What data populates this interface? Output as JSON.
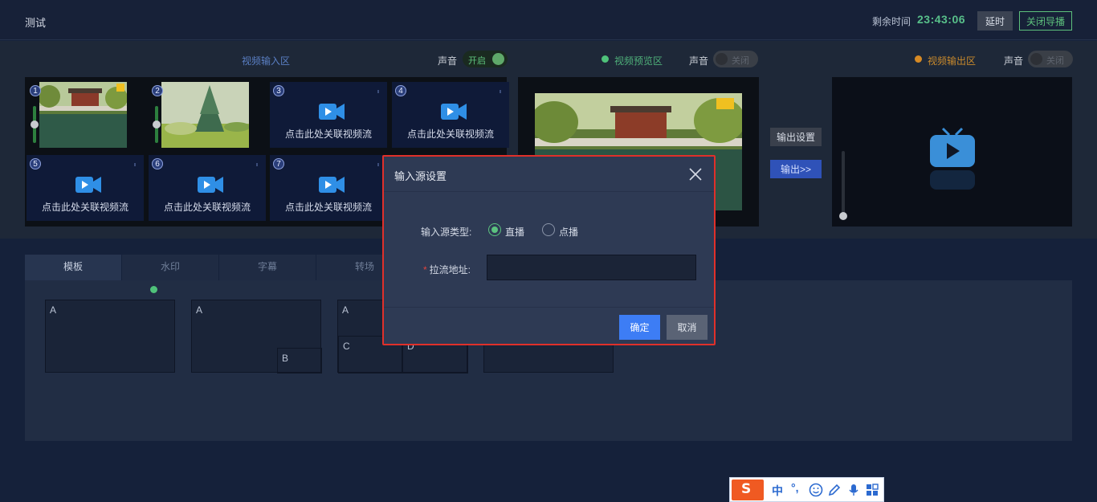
{
  "header": {
    "title": "测试",
    "remain_label": "剩余时间",
    "remain_time": "23:43:06",
    "delay_label": "延时",
    "close_live_label": "关闭导播"
  },
  "input_area": {
    "label": "视频输入区",
    "sound_label": "声音",
    "sound_toggle": "开启",
    "cells": [
      {
        "num": "1",
        "text": ""
      },
      {
        "num": "2",
        "text": ""
      },
      {
        "num": "3",
        "text": "点击此处关联视频流"
      },
      {
        "num": "4",
        "text": "点击此处关联视频流"
      },
      {
        "num": "5",
        "text": "点击此处关联视频流"
      },
      {
        "num": "6",
        "text": "点击此处关联视频流"
      },
      {
        "num": "7",
        "text": "点击此处关联视频流"
      }
    ]
  },
  "preview_area": {
    "label": "视频预览区",
    "sound_label": "声音",
    "sound_toggle": "关闭",
    "output_settings_label": "输出设置",
    "output_label": "输出>>"
  },
  "output_area": {
    "label": "视频输出区",
    "sound_label": "声音",
    "sound_toggle": "关闭"
  },
  "tabs": [
    {
      "label": "模板",
      "active": true
    },
    {
      "label": "水印",
      "active": false
    },
    {
      "label": "字幕",
      "active": false
    },
    {
      "label": "转场",
      "active": false
    }
  ],
  "templates": [
    {
      "labels": [
        "A"
      ]
    },
    {
      "labels": [
        "A",
        "B"
      ]
    },
    {
      "labels": [
        "A",
        "C",
        "D"
      ]
    }
  ],
  "modal": {
    "title": "输入源设置",
    "source_type_label": "输入源类型:",
    "option_live": "直播",
    "option_vod": "点播",
    "selected": "直播",
    "url_label": "拉流地址:",
    "url_value": "",
    "confirm_label": "确定",
    "cancel_label": "取消"
  },
  "ime": {
    "mode": "中",
    "punct": "°,"
  },
  "colors": {
    "accent_green": "#58c08a",
    "preview_dot": "#4fc27a",
    "output_dot": "#d78a24",
    "primary_blue": "#3d7df5",
    "modal_border": "#e0302a"
  }
}
